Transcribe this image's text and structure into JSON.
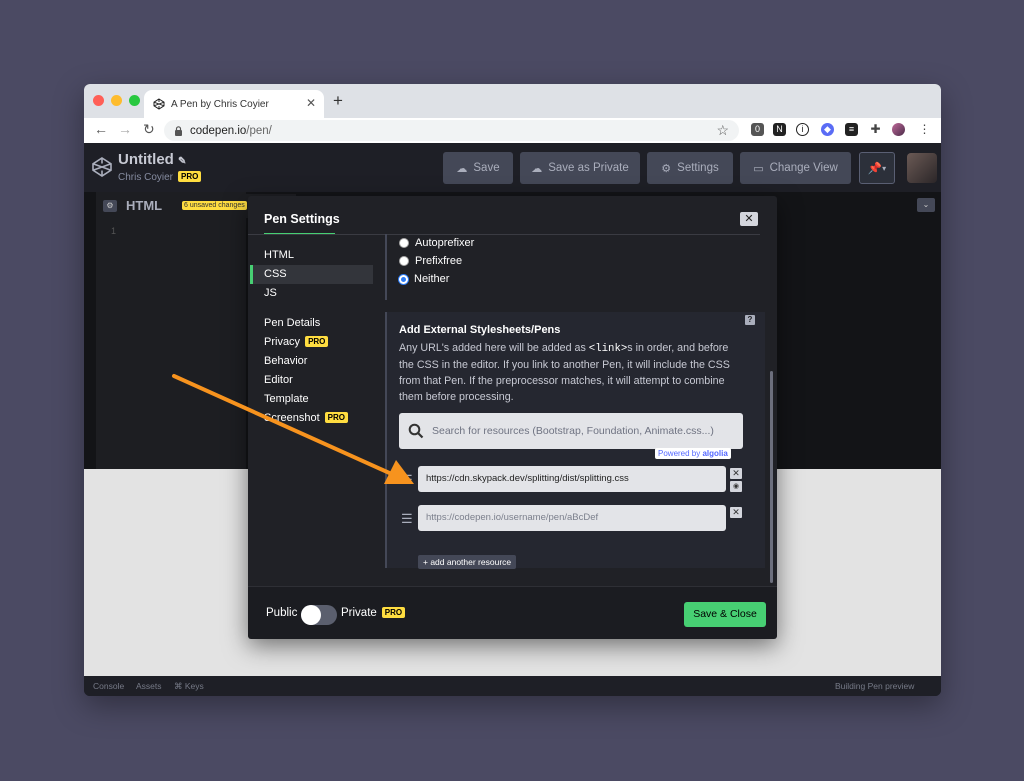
{
  "browser": {
    "tab_title": "A Pen by Chris Coyier",
    "tab_close": "✕",
    "new_tab": "+",
    "url_host": "codepen.io",
    "url_path": "/pen/",
    "extension_badge": "0"
  },
  "header": {
    "pen_title": "Untitled",
    "author": "Chris Coyier",
    "pro_label": "PRO",
    "buttons": {
      "save": "Save",
      "save_private": "Save as Private",
      "settings": "Settings",
      "change_view": "Change View"
    }
  },
  "editor": {
    "html_label": "HTML",
    "unsaved_badge": "6 unsaved changes",
    "line_number": "1"
  },
  "footer": {
    "console": "Console",
    "assets": "Assets",
    "keys": "⌘ Keys",
    "status": "Building Pen preview"
  },
  "modal": {
    "title": "Pen Settings",
    "close": "✕",
    "sidebar": {
      "html": "HTML",
      "css": "CSS",
      "js": "JS",
      "pen_details": "Pen Details",
      "privacy": "Privacy",
      "behavior": "Behavior",
      "editor": "Editor",
      "template": "Template",
      "screenshot": "Screenshot",
      "pro": "PRO"
    },
    "prefix_options": [
      "Autoprefixer",
      "Prefixfree",
      "Neither"
    ],
    "prefix_selected": "Neither",
    "external": {
      "title": "Add External Stylesheets/Pens",
      "desc_before": "Any URL's added here will be added as ",
      "desc_code": "<link>",
      "desc_after": "s in order, and before the CSS in the editor. If you link to another Pen, it will include the CSS from that Pen. If the preprocessor matches, it will attempt to combine them before processing.",
      "help": "?",
      "search_placeholder": "Search for resources (Bootstrap, Foundation, Animate.css...)",
      "powered_by": "Powered by",
      "algolia": "algolia",
      "resource_1": "https://cdn.skypack.dev/splitting/dist/splitting.css",
      "resource_2_placeholder": "https://codepen.io/username/pen/aBcDef",
      "add_resource": "+ add another resource"
    },
    "footer": {
      "public": "Public",
      "private": "Private",
      "pro": "PRO",
      "save_close": "Save & Close"
    }
  },
  "colors": {
    "accent_green": "#47cf73",
    "pro_yellow": "#ffdd40",
    "arrow_orange": "#f7931e"
  }
}
